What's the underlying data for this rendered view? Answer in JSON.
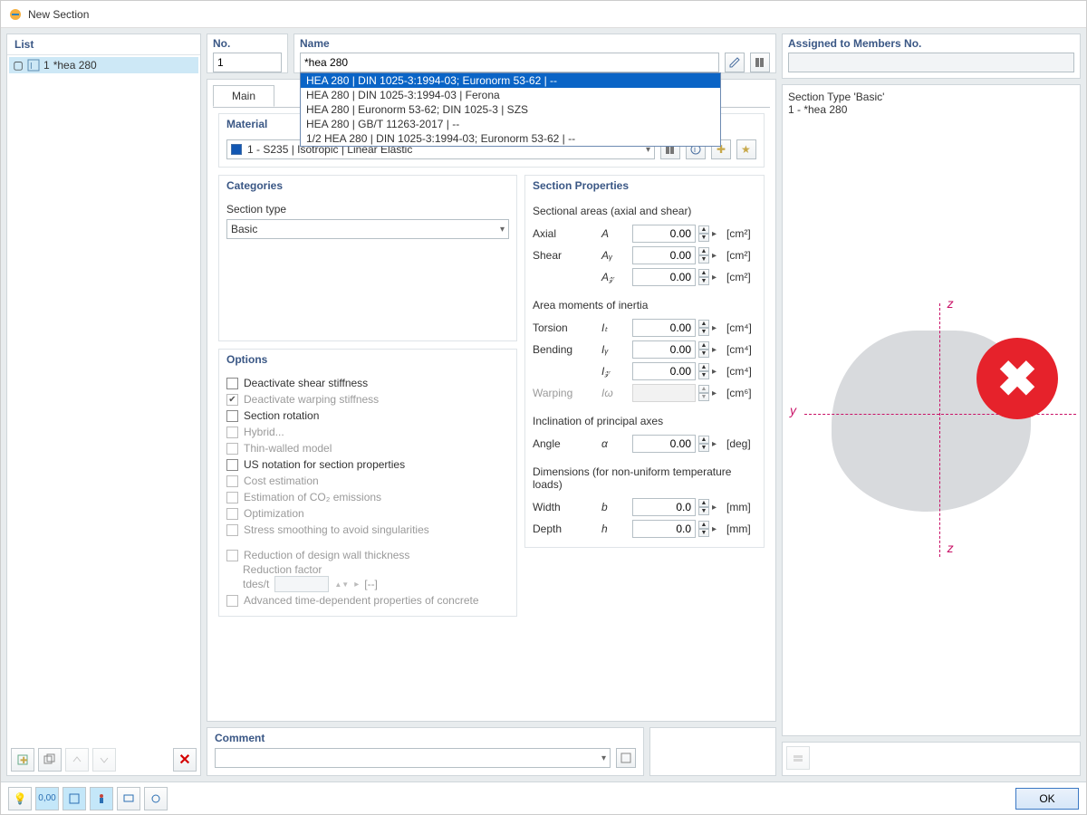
{
  "window": {
    "title": "New Section"
  },
  "left": {
    "header": "List",
    "items": [
      {
        "num": "1",
        "label": "*hea 280"
      }
    ],
    "toolbar_icons": [
      "new-item",
      "copy-item",
      "move-up",
      "move-down"
    ],
    "delete_title": "Delete"
  },
  "top": {
    "no_label": "No.",
    "no_value": "1",
    "name_label": "Name",
    "name_value": "*hea 280",
    "name_autocomplete": [
      "HEA 280 | DIN 1025-3:1994-03; Euronorm 53-62 | --",
      "HEA 280 | DIN 1025-3:1994-03 | Ferona",
      "HEA 280 | Euronorm 53-62; DIN 1025-3 | SZS",
      "HEA 280 | GB/T 11263-2017 | --",
      "1/2 HEA 280 | DIN 1025-3:1994-03; Euronorm 53-62 | --"
    ],
    "name_selected_index": 0,
    "assigned_label": "Assigned to Members No.",
    "assigned_value": ""
  },
  "tabs": {
    "items": [
      "Main"
    ],
    "active": 0
  },
  "material": {
    "group": "Material",
    "value": "1 - S235 | Isotropic | Linear Elastic"
  },
  "categories": {
    "group": "Categories",
    "type_label": "Section type",
    "type_value": "Basic"
  },
  "options": {
    "group": "Options",
    "items": [
      {
        "label": "Deactivate shear stiffness",
        "checked": false,
        "disabled": false
      },
      {
        "label": "Deactivate warping stiffness",
        "checked": true,
        "disabled": true
      },
      {
        "label": "Section rotation",
        "checked": false,
        "disabled": false
      },
      {
        "label": "Hybrid...",
        "checked": false,
        "disabled": true
      },
      {
        "label": "Thin-walled model",
        "checked": false,
        "disabled": true
      },
      {
        "label": "US notation for section properties",
        "checked": false,
        "disabled": false
      },
      {
        "label": "Cost estimation",
        "checked": false,
        "disabled": true
      },
      {
        "label": "Estimation of CO₂ emissions",
        "checked": false,
        "disabled": true
      },
      {
        "label": "Optimization",
        "checked": false,
        "disabled": true
      },
      {
        "label": "Stress smoothing to avoid singularities",
        "checked": false,
        "disabled": true
      }
    ],
    "reduction": {
      "label": "Reduction of design wall thickness",
      "factor_label": "Reduction factor",
      "factor_sym": "tdes/t",
      "factor_unit": "[--]"
    },
    "concrete": {
      "label": "Advanced time-dependent properties of concrete"
    }
  },
  "props": {
    "group": "Section Properties",
    "areas_title": "Sectional areas (axial and shear)",
    "areas": [
      {
        "label": "Axial",
        "sym": "A",
        "val": "0.00",
        "unit": "[cm²]"
      },
      {
        "label": "Shear",
        "sym": "Aᵧ",
        "val": "0.00",
        "unit": "[cm²]"
      },
      {
        "label": "",
        "sym": "A𝓏",
        "val": "0.00",
        "unit": "[cm²]"
      }
    ],
    "inertia_title": "Area moments of inertia",
    "inertia": [
      {
        "label": "Torsion",
        "sym": "Iₜ",
        "val": "0.00",
        "unit": "[cm⁴]"
      },
      {
        "label": "Bending",
        "sym": "Iᵧ",
        "val": "0.00",
        "unit": "[cm⁴]"
      },
      {
        "label": "",
        "sym": "I𝓏",
        "val": "0.00",
        "unit": "[cm⁴]"
      },
      {
        "label": "Warping",
        "sym": "Iω",
        "val": "",
        "unit": "[cm⁶]",
        "disabled": true
      }
    ],
    "incl_title": "Inclination of principal axes",
    "incl": [
      {
        "label": "Angle",
        "sym": "α",
        "val": "0.00",
        "unit": "[deg]"
      }
    ],
    "dim_title": "Dimensions (for non-uniform temperature loads)",
    "dim": [
      {
        "label": "Width",
        "sym": "b",
        "val": "0.0",
        "unit": "[mm]"
      },
      {
        "label": "Depth",
        "sym": "h",
        "val": "0.0",
        "unit": "[mm]"
      }
    ]
  },
  "comment": {
    "group": "Comment",
    "value": ""
  },
  "preview": {
    "type_line": "Section Type 'Basic'",
    "name_line": "1 - *hea 280",
    "axis_y": "y",
    "axis_z1": "z",
    "axis_z2": "z"
  },
  "bottom": {
    "ok": "OK"
  }
}
